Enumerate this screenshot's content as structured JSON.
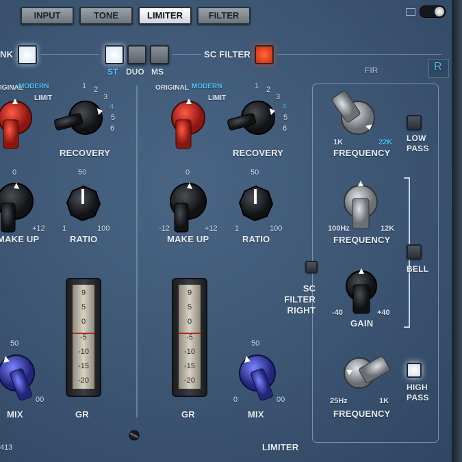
{
  "tabs": [
    {
      "label": "INPUT",
      "active": false
    },
    {
      "label": "TONE",
      "active": false
    },
    {
      "label": "LIMITER",
      "active": true
    },
    {
      "label": "FILTER",
      "active": false
    }
  ],
  "top_row": {
    "link_label": "NK",
    "st": "ST",
    "duo": "DUO",
    "ms": "MS",
    "sc_filter": "SC FILTER",
    "fir": "FIR",
    "channel": "R"
  },
  "left_strip": {
    "original": "IGINAL",
    "modern": "MODERN",
    "limit": "LIMIT",
    "recovery": "RECOVERY",
    "recovery_scale": [
      "1",
      "2",
      "3",
      "4",
      "5",
      "6"
    ],
    "makeup_top": "0",
    "makeup_right": "+12",
    "makeup": "MAKE UP",
    "ratio_top": "50",
    "ratio_left": "1",
    "ratio_right": "100",
    "ratio": "RATIO",
    "mix_top": "50",
    "mix_right": "00",
    "mix": "MIX",
    "gr": "GR",
    "footer": "413"
  },
  "right_strip": {
    "original": "ORIGINAL",
    "modern": "MODERN",
    "limit": "LIMIT",
    "recovery": "RECOVERY",
    "recovery_scale": [
      "1",
      "2",
      "3",
      "4",
      "5",
      "6"
    ],
    "makeup_top": "0",
    "makeup_left": "-12",
    "makeup_right": "+12",
    "makeup": "MAKE UP",
    "ratio_top": "50",
    "ratio_left": "1",
    "ratio_right": "100",
    "ratio": "RATIO",
    "mix_top": "50",
    "mix_left": "0",
    "mix_right": "00",
    "mix": "MIX",
    "gr": "GR",
    "footer": "LIMITER"
  },
  "meter_scale": [
    "9",
    "5",
    "0",
    "-5",
    "-10",
    "-15",
    "-20"
  ],
  "sc_filter_right": [
    "SC",
    "FILTER",
    "RIGHT"
  ],
  "filter_section": {
    "lowpass_freq_min": "1K",
    "lowpass_freq_max": "22K",
    "lowpass_freq": "FREQUENCY",
    "low_pass": [
      "LOW",
      "PASS"
    ],
    "bell_freq_min": "100Hz",
    "bell_freq_max": "12K",
    "bell_freq": "FREQUENCY",
    "bell": "BELL",
    "gain_min": "-40",
    "gain_max": "+40",
    "gain": "GAIN",
    "highpass_freq_min": "25Hz",
    "highpass_freq_max": "1K",
    "highpass_freq": "FREQUENCY",
    "high_pass": [
      "HIGH",
      "PASS"
    ]
  },
  "colors": {
    "accent_cyan": "#4fc3f7",
    "panel_blue": "#3b5472",
    "sc_filter_led": "#e0401a",
    "knob_red": "#c42a1f",
    "knob_blue": "#3a3fb0",
    "knob_grey": "#8e9398"
  }
}
